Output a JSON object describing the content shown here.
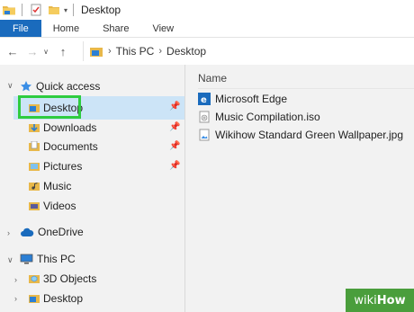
{
  "window": {
    "title": "Desktop"
  },
  "ribbon": {
    "tabs": [
      "File",
      "Home",
      "Share",
      "View"
    ]
  },
  "address": {
    "crumbs": [
      "This PC",
      "Desktop"
    ]
  },
  "navpane": {
    "quick_access": "Quick access",
    "items": [
      "Desktop",
      "Downloads",
      "Documents",
      "Pictures",
      "Music",
      "Videos"
    ],
    "onedrive": "OneDrive",
    "thispc": "This PC",
    "pc_items": [
      "3D Objects",
      "Desktop"
    ]
  },
  "content": {
    "column_header": "Name",
    "files": [
      {
        "name": "Microsoft Edge",
        "icon": "edge-shortcut-icon"
      },
      {
        "name": "Music Compilation.iso",
        "icon": "iso-file-icon"
      },
      {
        "name": "Wikihow Standard Green Wallpaper.jpg",
        "icon": "image-file-icon"
      }
    ]
  },
  "watermark": {
    "part1": "wiki",
    "part2": "How"
  },
  "colors": {
    "accent": "#1a6bbd",
    "selection": "#cce4f7",
    "highlight": "#2ecc40"
  }
}
